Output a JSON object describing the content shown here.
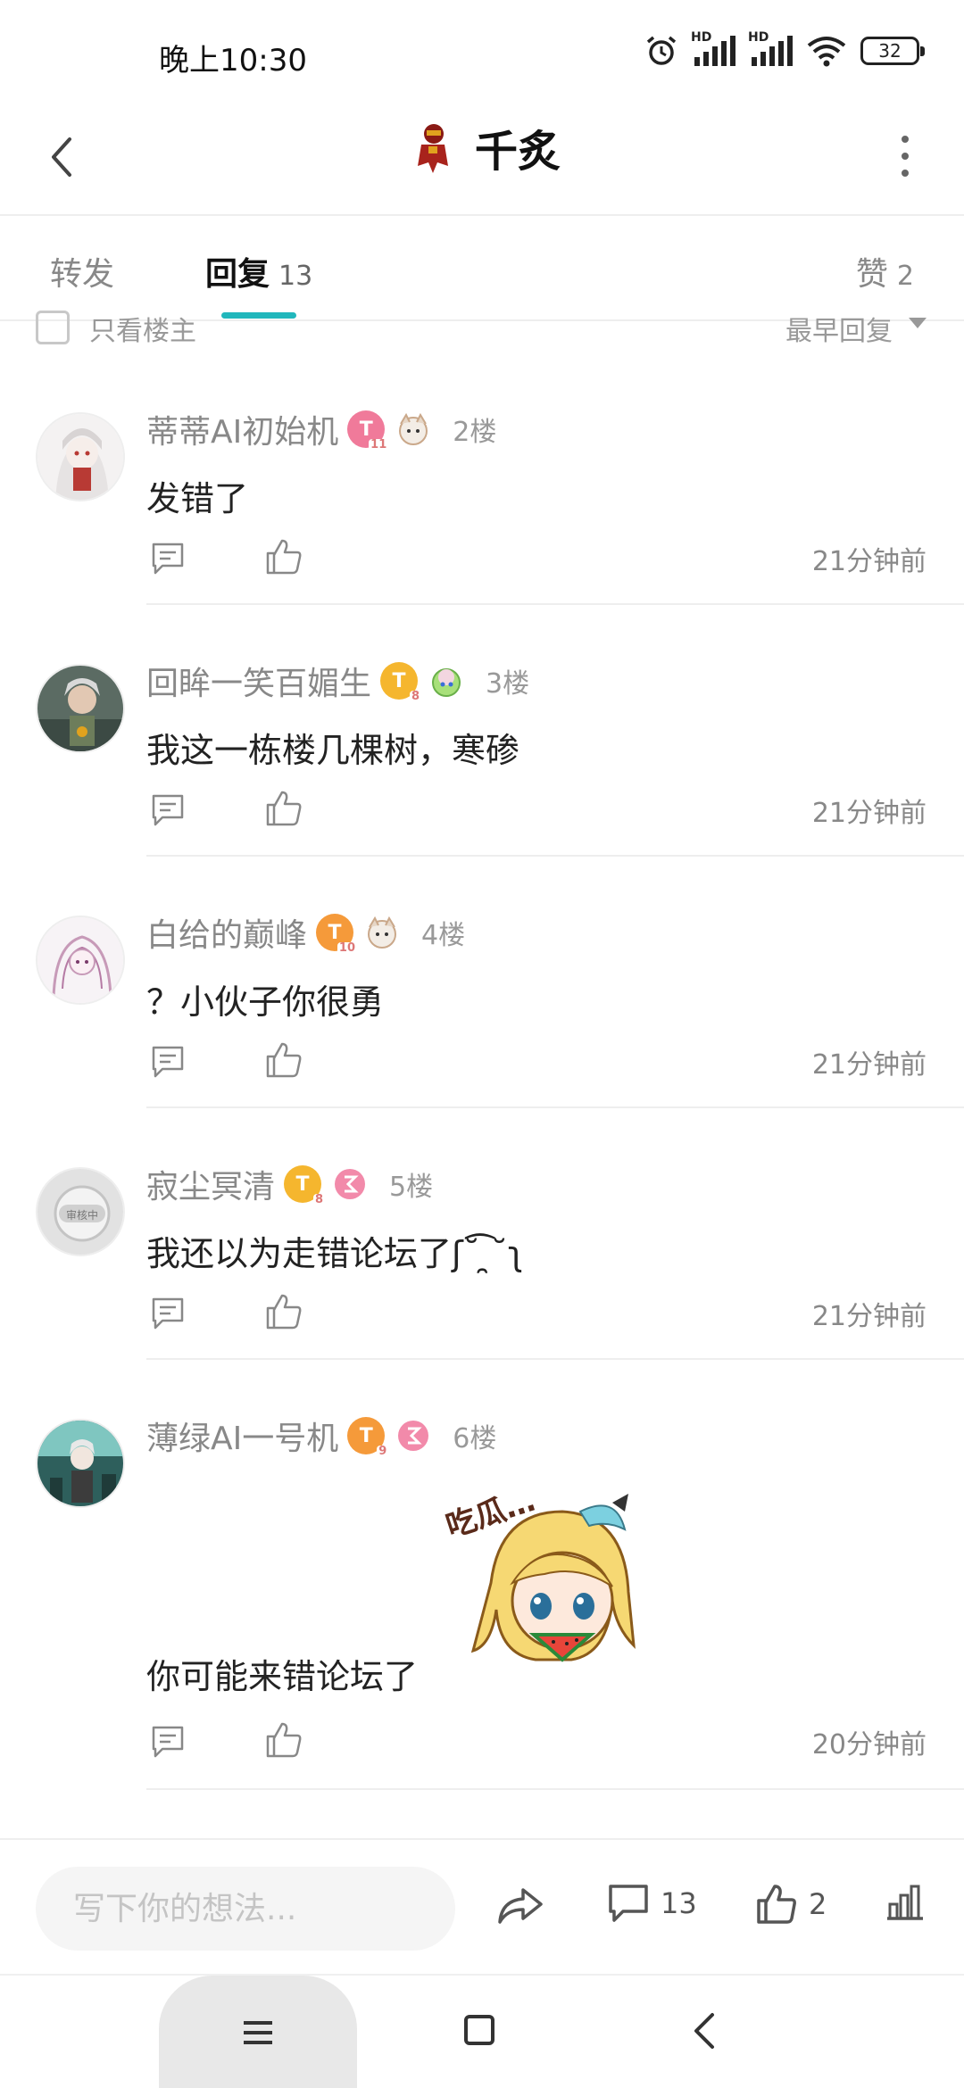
{
  "status_bar": {
    "time": "晚上10:30",
    "battery": "32",
    "icons": [
      "alarm-icon",
      "hd-signal-icon",
      "hd-signal-icon",
      "wifi-icon",
      "battery-icon"
    ]
  },
  "header": {
    "title": "千炙",
    "back_icon": "chevron-left-icon",
    "more_icon": "more-vertical-icon"
  },
  "tabs": {
    "repost": "转发",
    "reply": "回复",
    "reply_count": "13",
    "like": "赞",
    "like_count": "2",
    "accent": "#21b7bc"
  },
  "filter": {
    "only_op": "只看楼主",
    "sort": "最早回复"
  },
  "comments": [
    {
      "username": "蒂蒂AI初始机",
      "floor": "2楼",
      "content": "发错了",
      "time": "21分钟前",
      "badge_level": "11",
      "badge_color": "#f07a9a"
    },
    {
      "username": "回眸一笑百媚生",
      "floor": "3楼",
      "content": "我这一栋楼几棵树，寒碜",
      "time": "21分钟前",
      "badge_level": "8",
      "badge_color": "#f5b62e"
    },
    {
      "username": "白给的巅峰",
      "floor": "4楼",
      "content": "？小伙子你很勇",
      "time": "21分钟前",
      "badge_level": "10",
      "badge_color": "#f59a3a"
    },
    {
      "username": "寂尘冥清",
      "floor": "5楼",
      "content": "我还以为走错论坛了ʃ˘͡ ̯˘ʅ",
      "time": "21分钟前",
      "badge_level": "8",
      "badge_color": "#f5b62e",
      "avatar_text": "审核中"
    },
    {
      "username": "薄绿AI一号机",
      "floor": "6楼",
      "content": "你可能来错论坛了",
      "time": "20分钟前",
      "badge_level": "9",
      "badge_color": "#f59a3a",
      "sticker_text": "吃瓜…"
    }
  ],
  "bottom_bar": {
    "placeholder": "写下你的想法...",
    "comment_count": "13",
    "like_count": "2"
  }
}
